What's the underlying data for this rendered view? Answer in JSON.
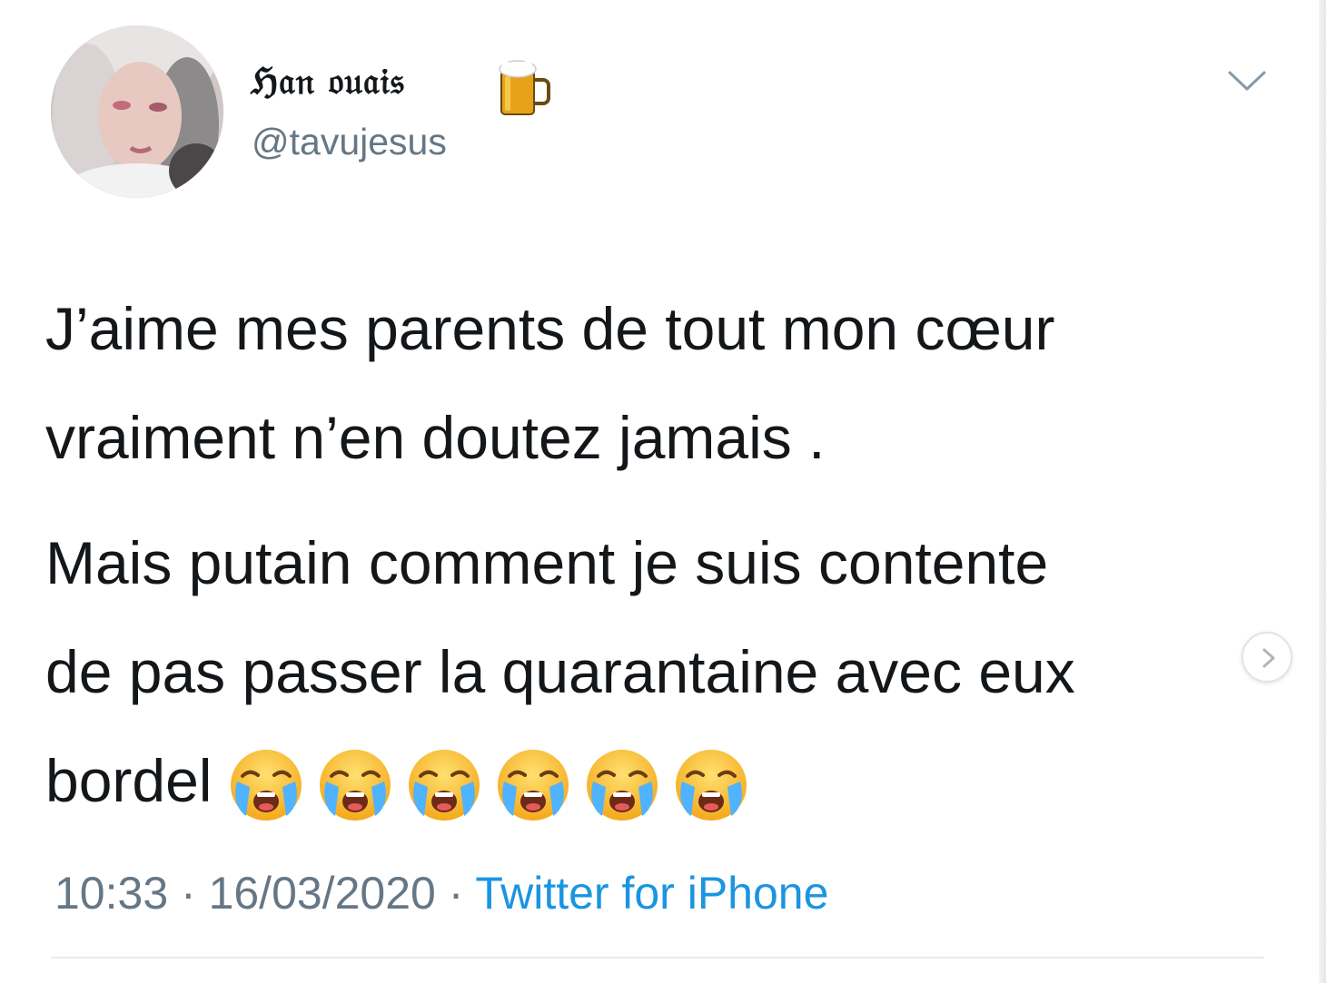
{
  "author": {
    "display_name": "ℌ𝔞𝔫 𝔬𝔲𝔞𝔦𝔰",
    "handle": "@tavujesus",
    "name_emoji": "beer-mug-icon",
    "avatar": "user-avatar-photo"
  },
  "tweet": {
    "lines": [
      "J’aime mes parents de tout mon cœur",
      "vraiment n’en doutez jamais .",
      "Mais putain comment je suis contente",
      "de pas passer la quarantaine avec eux",
      "bordel"
    ],
    "emoji": "loudly-crying-face-icon",
    "emoji_count": 6
  },
  "meta": {
    "time": "10:33",
    "separator": " · ",
    "date": "16/03/2020",
    "source": "Twitter for iPhone"
  },
  "colors": {
    "text": "#14171a",
    "secondary": "#657786",
    "link": "#1b95e0",
    "divider": "#e6ecf0"
  },
  "icons": {
    "menu": "chevron-down-icon",
    "next": "chevron-right-icon"
  }
}
